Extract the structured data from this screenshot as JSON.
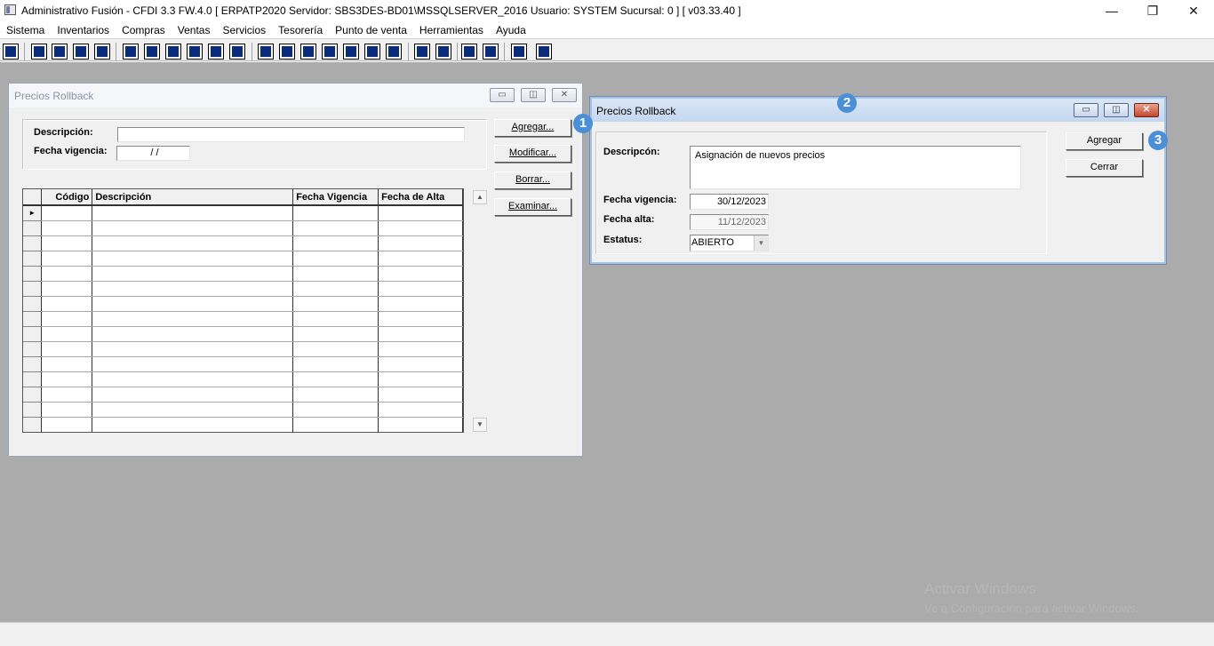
{
  "window": {
    "title": "Administrativo Fusión - CFDI 3.3 FW.4.0 [ ERPATP2020  Servidor: SBS3DES-BD01\\MSSQLSERVER_2016   Usuario: SYSTEM    Sucursal: 0 ] [ v03.33.40 ]",
    "controls": {
      "minimize": "—",
      "restore": "❐",
      "close": "✕"
    }
  },
  "menu": [
    "Sistema",
    "Inventarios",
    "Compras",
    "Ventas",
    "Servicios",
    "Tesorería",
    "Punto de venta",
    "Herramientas",
    "Ayuda"
  ],
  "win_list": {
    "title": "Precios Rollback",
    "controls": {
      "minimize": "▭",
      "restore": "◫",
      "close": "✕"
    },
    "labels": {
      "descripcion": "Descripción:",
      "fecha_vigencia": "Fecha vigencia:"
    },
    "fields": {
      "descripcion": "",
      "fecha_vigencia": "/ /"
    },
    "buttons": {
      "agregar": "Agregar...",
      "modificar": "Modificar...",
      "borrar": "Borrar...",
      "examinar": "Examinar..."
    },
    "grid": {
      "columns": [
        "Código",
        "Descripción",
        "Fecha Vigencia",
        "Fecha de Alta"
      ],
      "current_row_marker": "►"
    }
  },
  "win_form": {
    "title": "Precios Rollback",
    "controls": {
      "minimize": "▭",
      "restore": "◫",
      "close": "✕"
    },
    "labels": {
      "descripcion": "Descripcón:",
      "fecha_vigencia": "Fecha vigencia:",
      "fecha_alta": "Fecha alta:",
      "estatus": "Estatus:"
    },
    "fields": {
      "descripcion": "Asignación de nuevos precios",
      "fecha_vigencia": "30/12/2023",
      "fecha_alta": "11/12/2023",
      "estatus": "ABIERTO"
    },
    "buttons": {
      "agregar": "Agregar",
      "cerrar": "Cerrar"
    }
  },
  "badges": [
    "1",
    "2",
    "3"
  ],
  "watermark": {
    "line1": "Activar Windows",
    "line2": "Ve a Configuración para activar Windows."
  },
  "colors": {
    "mdi_background": "#ababab",
    "badge": "#4b90d6",
    "active_caption": "#c4d7ef"
  }
}
